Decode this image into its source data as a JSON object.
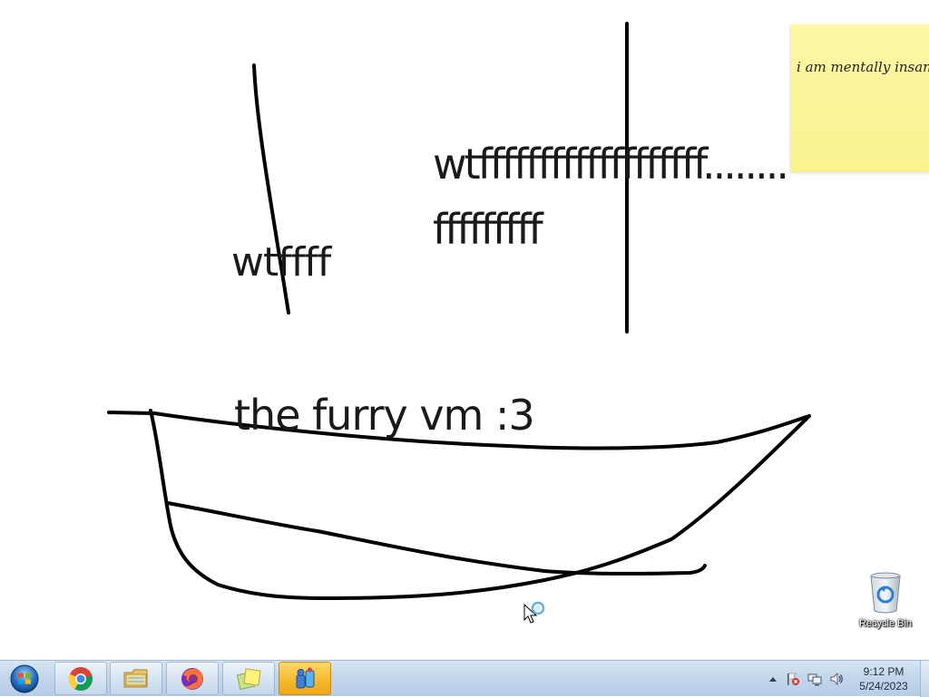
{
  "desktop": {
    "texts": {
      "wtffff": "wtffff",
      "long_line_1": "wtfffffffffffffffffff........",
      "long_line_2": "fffffffff",
      "furry": "the furry vm :3"
    },
    "sticky_note": {
      "text": "i am mentally insane",
      "color": "#fbf28f"
    },
    "icons": [
      {
        "name": "recycle-bin-icon",
        "label": "Recycle Bin"
      }
    ],
    "cursor": "busy-arrow-cursor"
  },
  "taskbar": {
    "start_icon": "windows-start-orb-icon",
    "pinned": [
      {
        "name": "chrome-icon"
      },
      {
        "name": "file-explorer-icon"
      },
      {
        "name": "firefox-icon"
      },
      {
        "name": "sticky-notes-icon"
      },
      {
        "name": "paint-icon",
        "active": true
      }
    ],
    "tray": {
      "icons": [
        "show-hidden-icons-icon",
        "action-center-flag-icon",
        "network-icon",
        "volume-icon"
      ],
      "time": "9:12 PM",
      "date": "5/24/2023"
    },
    "accent": "#f0a818"
  }
}
